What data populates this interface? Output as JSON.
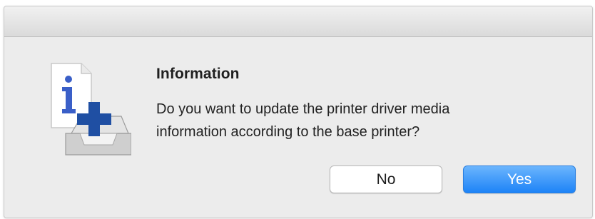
{
  "dialog": {
    "title": "Information",
    "message_line1": "Do you want to update the printer driver media",
    "message_line2": "information according to the base printer?",
    "icon": "info-document-tray-plus-icon",
    "buttons": {
      "no_label": "No",
      "yes_label": "Yes"
    }
  },
  "colors": {
    "dialog_background": "#ececec",
    "default_button": "#1d83f7",
    "icon_info_glyph": "#3a5fc8",
    "icon_plus": "#1f4fa3"
  }
}
